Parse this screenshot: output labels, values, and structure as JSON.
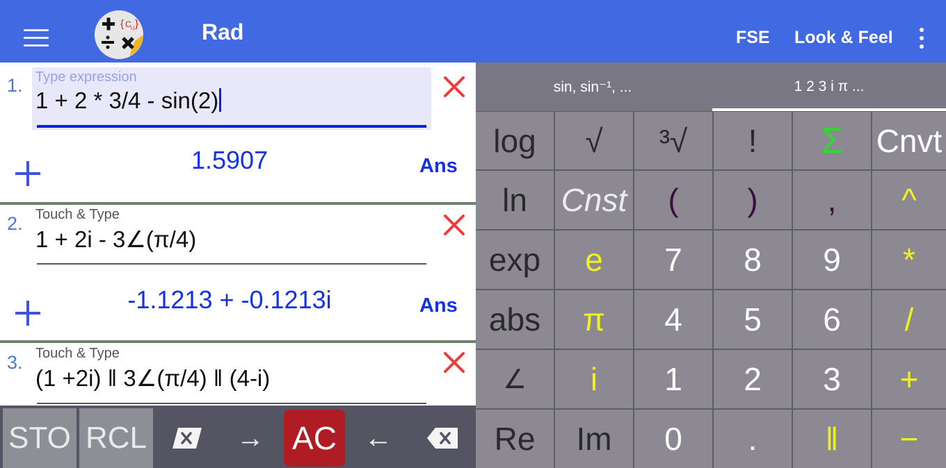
{
  "appbar": {
    "mode": "Rad",
    "menu_fse": "FSE",
    "menu_look": "Look & Feel",
    "color": "#4169e1"
  },
  "entries": [
    {
      "number": "1.",
      "hint": "Type expression",
      "expression": "1 + 2 * 3/4 - sin(2)",
      "result": "1.5907",
      "ans": "Ans"
    },
    {
      "number": "2.",
      "hint": "Touch & Type",
      "expression": "1 + 2i - 3∠(π/4)",
      "result": "-1.1213 + -0.1213i",
      "ans": "Ans"
    },
    {
      "number": "3.",
      "hint": "Touch & Type",
      "expression": "(1 +2i) ‖ 3∠(π/4) ‖ (4-i)"
    }
  ],
  "editbar": {
    "sto": "STO",
    "rcl": "RCL",
    "right_arrow": "→",
    "ac": "AC",
    "left_arrow": "←"
  },
  "keyboard": {
    "tabs": [
      "sin, sin⁻¹, ...",
      "1 2 3 i π ..."
    ],
    "active_tab": 1,
    "rows": [
      [
        "log",
        "√",
        "³√",
        "!",
        "Σ",
        "Cnvt"
      ],
      [
        "ln",
        "Cnst",
        "(",
        ")",
        ",",
        "^"
      ],
      [
        "exp",
        "e",
        "7",
        "8",
        "9",
        "*"
      ],
      [
        "abs",
        "π",
        "4",
        "5",
        "6",
        "/"
      ],
      [
        "∠",
        "i",
        "1",
        "2",
        "3",
        "+"
      ],
      [
        "Re",
        "Im",
        "0",
        ".",
        "‖",
        "−"
      ]
    ]
  }
}
